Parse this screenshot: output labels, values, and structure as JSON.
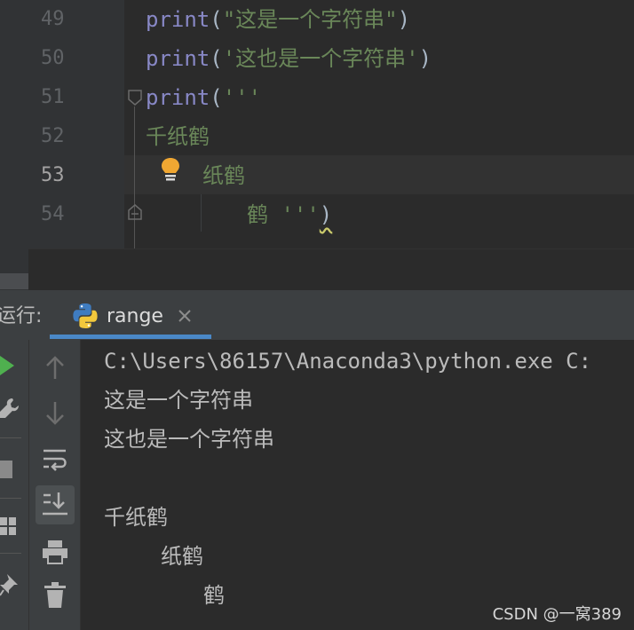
{
  "editor": {
    "lines": [
      {
        "num": "49",
        "parts": [
          "print",
          "(",
          "\"这是一个字符串\"",
          ")"
        ]
      },
      {
        "num": "50",
        "parts": [
          "print",
          "(",
          "'这也是一个字符串'",
          ")"
        ]
      },
      {
        "num": "51",
        "parts": [
          "print",
          "(",
          "'''"
        ]
      },
      {
        "num": "52",
        "text": "千纸鹤"
      },
      {
        "num": "53",
        "text": "纸鹤"
      },
      {
        "num": "54",
        "text": "鹤 '''",
        "close": ")"
      }
    ],
    "current_line": "53"
  },
  "run_panel": {
    "label": "运行:",
    "tab": {
      "label": "range",
      "icon": "python-icon"
    },
    "toolbar_left": [
      "run-icon",
      "wrench-icon",
      "stop-icon",
      "layout-icon",
      "pin-icon"
    ],
    "toolbar": [
      "up-arrow-icon",
      "down-arrow-icon",
      "soft-wrap-icon",
      "scroll-to-end-icon",
      "print-icon",
      "trash-icon"
    ],
    "output": {
      "command": "C:\\Users\\86157\\Anaconda3\\python.exe C:",
      "line1": "这是一个字符串",
      "line2": "这也是一个字符串",
      "line3": "千纸鹤",
      "line4": "纸鹤",
      "line5": "鹤"
    }
  },
  "watermark": "CSDN @一窝389",
  "colors": {
    "keyword": "#8888c6",
    "string": "#6a8759",
    "accent": "#4a88c7"
  }
}
